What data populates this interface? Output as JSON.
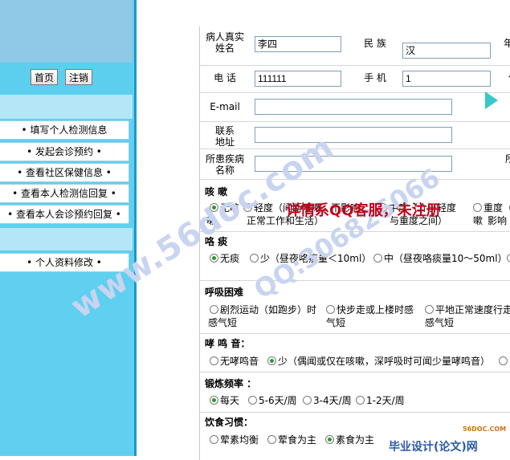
{
  "sidebar": {
    "buttons": {
      "home": "首页",
      "logout": "注销"
    },
    "menu": [
      "• 填写个人检测信息",
      "• 发起会诊预约 •",
      "• 查看社区保健信息 •",
      "• 查看本人检测信回复 •",
      "• 查看本人会诊预约回复 •"
    ],
    "menu2": [
      "• 个人资料修改 •"
    ]
  },
  "form": {
    "name_label": "病人真实姓名",
    "name_value": "李四",
    "ethnic_label": "民 族",
    "ethnic_value": "汉",
    "phone_label": "电 话",
    "phone_value": "111111",
    "mobile_label": "手 机",
    "mobile_value": "1",
    "email_label": "E-mail",
    "address_label": "联系地址",
    "disease_label": "所患疾病名称",
    "edge_age": "年",
    "edge_other": "何",
    "edge_disease": "所",
    "cough": {
      "title": "咳 嗽",
      "opt1": "无咳",
      "opt2": "轻度（间断咳嗽，不影响",
      "opt3": "中度（介于轻度",
      "opt4": "重度（",
      "line2a": "正常工作和生活）",
      "line2b": "与重度之间）",
      "line2c": "影响",
      "edge": "嗽",
      "edge2": "嗽"
    },
    "sputum": {
      "title": "咯 痰",
      "opt1": "无痰",
      "opt2": "少（昼夜咯痰量＜10ml）",
      "opt3": "中（昼夜咯痰量10～50ml）"
    },
    "dyspnea": {
      "title": "呼吸困难",
      "opt1": "剧烈运动（如跑步）时",
      "opt1b": "感气短",
      "opt2": "快步走或上楼时感",
      "opt2b": "气短",
      "opt3": "平地正常速度行走",
      "opt3b": "感气短"
    },
    "wheeze": {
      "title": "哮 鸣 音：",
      "opt1": "无哮鸣音",
      "opt2": "少（偶闻或仅在咳嗽，深呼吸时可闻少量哮鸣音）"
    },
    "exercise": {
      "title": "锻炼频率 ：",
      "opts": [
        "每天",
        "5-6天/周",
        "3-4天/周",
        "1-2天/周"
      ]
    },
    "diet": {
      "title": "饮食习惯：",
      "opts": [
        "荤素均衡",
        "荤食为主",
        "素食为主"
      ]
    }
  },
  "watermarks": {
    "site1": "www.56doc.com",
    "qq": "QQ:306826066",
    "banner": "详情系QQ客服，未注册",
    "corner_top": "56DOC.COM",
    "corner_bottom": "毕业设计(论文)网"
  }
}
